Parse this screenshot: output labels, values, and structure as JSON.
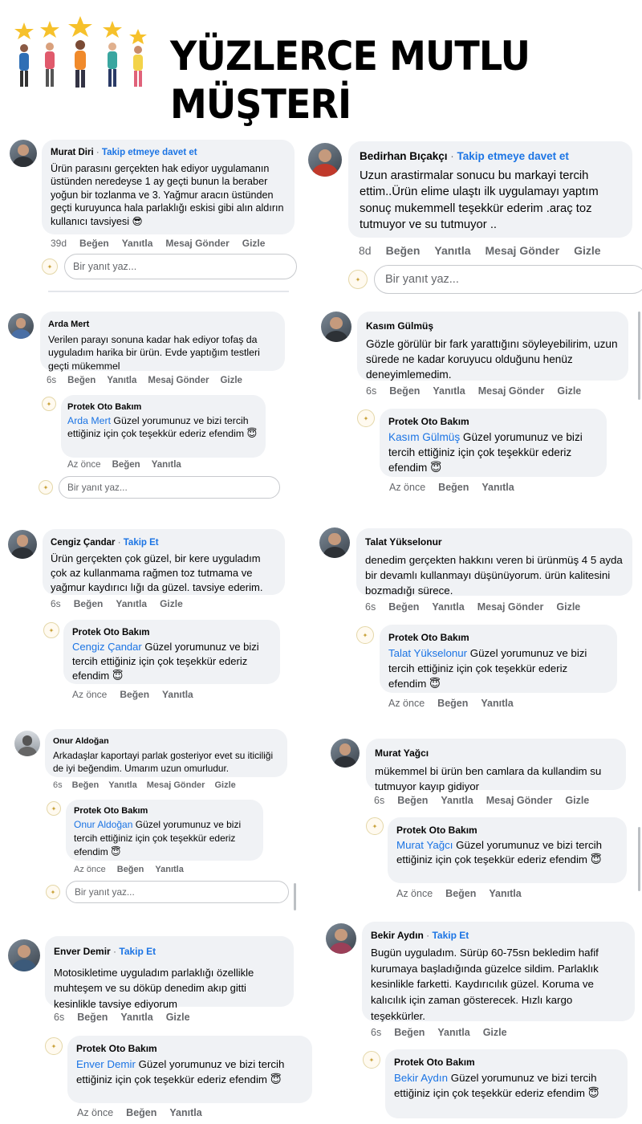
{
  "banner": {
    "title": "YÜZLERCE MUTLU MÜŞTERİ"
  },
  "labels": {
    "like": "Beğen",
    "reply": "Yanıtla",
    "send_message": "Mesaj Gönder",
    "hide": "Gizle",
    "reply_placeholder": "Bir yanıt yaz...",
    "now": "Az önce"
  },
  "shop": {
    "name": "Protek Oto Bakım"
  },
  "reply_emoji": "😇",
  "reviews": [
    {
      "name": "Murat Diri",
      "invite": "Takip etmeye davet et",
      "time": "39d",
      "text": "Ürün parasını gerçekten hak ediyor uygulamanın üstünden neredeyse 1 ay geçti bunun la beraber yoğun bir tozlanma ve 3. Yağmur aracın üstünden geçti kuruyunca hala parlaklığı eskisi gibi alın aldırın kullanıcı tavsiyesi 😎"
    },
    {
      "name": "Bedirhan Bıçakçı",
      "invite": "Takip etmeye davet et",
      "time": "8d",
      "text": "Uzun arastirmalar sonucu bu markayi tercih ettim..Ürün elime ulaştı ilk uygulamayı yaptım sonuç mukemmell teşekkür ederim .araç toz tutmuyor ve su tutmuyor .."
    },
    {
      "name": "Arda Mert",
      "time": "6s",
      "text": "Verilen parayı sonuna kadar hak ediyor tofaş da uyguladım harika bir ürün. Evde yaptığım testleri geçti mükemmel",
      "reply": "Arda Mert",
      "reply_text": "Güzel yorumunuz ve bizi tercih ettiğiniz için çok teşekkür ederiz efendim"
    },
    {
      "name": "Kasım Gülmüş",
      "time": "6s",
      "text": "Gözle görülür bir fark yarattığını söyleyebilirim, uzun süredе ne kadar koruyucu olduğunu henüz deneyimlemedim.",
      "reply": "Kasım Gülmüş",
      "reply_text": "Güzel yorumunuz ve bizi tercih ettiğiniz için çok teşekkür ederiz efendim"
    },
    {
      "name": "Cengiz Çandar",
      "invite": "Takip Et",
      "time": "6s",
      "text": "Ürün gerçekten çok güzel, bir kere uyguladım çok az kullanmama rağmen toz tutmama ve yağmur kaydırıcı lığı da güzel. tavsiye ederim.",
      "reply": "Cengiz Çandar",
      "reply_text": "Güzel yorumunuz ve bizi tercih ettiğiniz için çok teşekkür ederiz efendim"
    },
    {
      "name": "Talat Yükselonur",
      "time": "6s",
      "text": "denedim gerçekten hakkını veren bi ürünmüş 4 5 ayda bir devamlı kullanmayı düşünüyorum. ürün kalitesini bozmadığı sürece.",
      "reply": "Talat Yükselonur",
      "reply_text": "Güzel yorumunuz ve bizi tercih ettiğiniz için çok teşekkür ederiz efendim"
    },
    {
      "name": "Onur Aldoğan",
      "time": "6s",
      "text": "Arkadaşlar kaportayi parlak gosteriyor evet su iticiliği de iyi beğendim. Umarım uzun omurludur.",
      "reply": "Onur Aldoğan",
      "reply_text": "Güzel yorumunuz ve bizi tercih ettiğiniz için çok teşekkür ederiz efendim"
    },
    {
      "name": "Murat Yağcı",
      "time": "6s",
      "text": "mükemmel bi ürün ben camlara da kullandim su tutmuyor kayıp gidiyor",
      "reply": "Murat Yağcı",
      "reply_text": "Güzel yorumunuz ve bizi tercih ettiğiniz için çok teşekkür ederiz efendim"
    },
    {
      "name": "Enver Demir",
      "invite": "Takip Et",
      "time": "6s",
      "text": "Motosikletime uyguladım parlaklığı özellikle muhteşem ve su döküp denedim akıp gitti kesinlikle tavsiye ediyorum",
      "reply": "Enver Demir",
      "reply_text": "Güzel yorumunuz ve bizi tercih ettiğiniz için çok teşekkür ederiz efendim"
    },
    {
      "name": "Bekir Aydın",
      "invite": "Takip Et",
      "time": "6s",
      "text": "Bugün uyguladım. Sürüp 60-75sn bekledim hafif kurumaya başladığında güzelce sildim. Parlaklık kesinlikle farketti. Kaydırıcılık güzel. Koruma ve kalıcılık için zaman gösterecek. Hızlı kargo teşekkürler.",
      "reply": "Bekir Aydın",
      "reply_text": "Güzel yorumunuz ve bizi tercih ettiğiniz için çok teşekkür ederiz efendim"
    }
  ]
}
